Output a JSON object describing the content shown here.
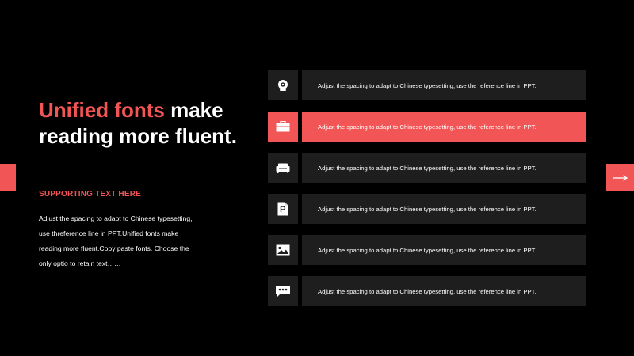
{
  "headline": {
    "accent": "Unified fonts",
    "line1_rest": " make",
    "line2": "reading more fluent."
  },
  "supporting_title": "SUPPORTING TEXT HERE",
  "body_lines": [
    "Adjust the spacing to adapt to Chinese typesetting,",
    "use threference line in PPT.Unified fonts make",
    "reading more fluent.Copy paste fonts. Choose the",
    "only optio to retain text……"
  ],
  "rows": [
    {
      "icon": "webcam-icon",
      "text": "Adjust the spacing to adapt to Chinese typesetting, use the reference line in PPT.",
      "active": false
    },
    {
      "icon": "briefcase-icon",
      "text": "Adjust the spacing to adapt to Chinese typesetting, use the reference line in PPT.",
      "active": true
    },
    {
      "icon": "sofa-icon",
      "text": "Adjust the spacing to adapt to Chinese typesetting, use the reference line in PPT.",
      "active": false
    },
    {
      "icon": "document-p-icon",
      "text": "Adjust the spacing to adapt to Chinese typesetting, use the reference line in PPT.",
      "active": false
    },
    {
      "icon": "image-icon",
      "text": "Adjust the spacing to adapt to Chinese typesetting, use the reference line in PPT.",
      "active": false
    },
    {
      "icon": "chat-bubble-icon",
      "text": "Adjust the spacing to adapt to Chinese typesetting, use the reference line in PPT.",
      "active": false
    }
  ],
  "nav": {
    "next_icon": "arrow-right-icon"
  },
  "colors": {
    "accent": "#f25555",
    "background": "#000000",
    "panel": "#1e1e1e",
    "text": "#ffffff"
  }
}
